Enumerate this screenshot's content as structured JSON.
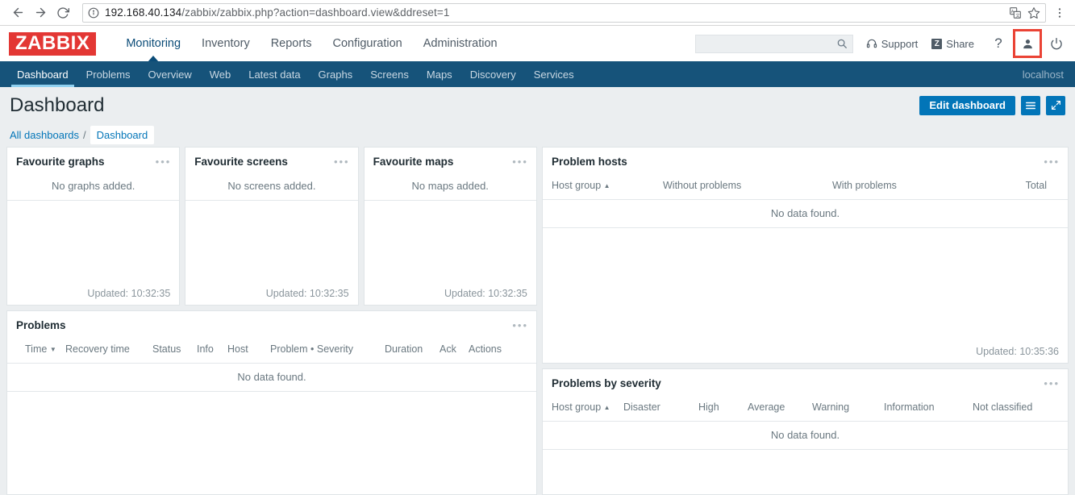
{
  "browser": {
    "back_icon": "back-arrow-icon",
    "forward_icon": "forward-arrow-icon",
    "reload_icon": "reload-icon",
    "site_info_icon": "site-info-icon",
    "url_host": "192.168.40.134",
    "url_path": "/zabbix/zabbix.php?action=dashboard.view&ddreset=1",
    "translate_icon": "translate-icon",
    "bookmark_icon": "star-icon",
    "menu_icon": "chrome-menu-icon"
  },
  "header": {
    "logo_text": "ZABBIX",
    "logo_color": "#e33734",
    "menu": [
      {
        "label": "Monitoring",
        "active": true
      },
      {
        "label": "Inventory",
        "active": false
      },
      {
        "label": "Reports",
        "active": false
      },
      {
        "label": "Configuration",
        "active": false
      },
      {
        "label": "Administration",
        "active": false
      }
    ],
    "search_value": "",
    "search_placeholder": "",
    "search_icon": "search-icon",
    "support_label": "Support",
    "support_icon": "headset-icon",
    "share_label": "Share",
    "share_icon": "zabbix-share-icon",
    "help_label": "?",
    "user_icon": "user-profile-icon",
    "user_highlight_color": "#ea4335",
    "signout_icon": "power-icon"
  },
  "nav": {
    "items": [
      {
        "label": "Dashboard",
        "active": true
      },
      {
        "label": "Problems",
        "active": false
      },
      {
        "label": "Overview",
        "active": false
      },
      {
        "label": "Web",
        "active": false
      },
      {
        "label": "Latest data",
        "active": false
      },
      {
        "label": "Graphs",
        "active": false
      },
      {
        "label": "Screens",
        "active": false
      },
      {
        "label": "Maps",
        "active": false
      },
      {
        "label": "Discovery",
        "active": false
      },
      {
        "label": "Services",
        "active": false
      }
    ],
    "host": "localhost",
    "background": "#16537a",
    "active_underline": "#8fd0f0"
  },
  "page": {
    "title": "Dashboard",
    "edit_button": "Edit dashboard",
    "menu_button_icon": "hamburger-menu-icon",
    "fullscreen_button_icon": "expand-arrows-icon",
    "accent_color": "#0275b8",
    "breadcrumb": {
      "root": "All dashboards",
      "separator": "/",
      "current": "Dashboard"
    }
  },
  "widgets": {
    "favourite_graphs": {
      "title": "Favourite graphs",
      "empty": "No graphs added.",
      "updated": "Updated: 10:32:35",
      "menu_icon": "widget-menu-icon"
    },
    "favourite_screens": {
      "title": "Favourite screens",
      "empty": "No screens added.",
      "updated": "Updated: 10:32:35",
      "menu_icon": "widget-menu-icon"
    },
    "favourite_maps": {
      "title": "Favourite maps",
      "empty": "No maps added.",
      "updated": "Updated: 10:32:35",
      "menu_icon": "widget-menu-icon"
    },
    "problem_hosts": {
      "title": "Problem hosts",
      "columns": [
        "Host group",
        "Without problems",
        "With problems",
        "Total"
      ],
      "sort_column": "Host group",
      "sort_dir": "▲",
      "no_data": "No data found.",
      "updated": "Updated: 10:35:36",
      "menu_icon": "widget-menu-icon"
    },
    "problems": {
      "title": "Problems",
      "columns": [
        "Time",
        "Recovery time",
        "Status",
        "Info",
        "Host",
        "Problem • Severity",
        "Duration",
        "Ack",
        "Actions"
      ],
      "sort_column": "Time",
      "sort_dir": "▼",
      "no_data": "No data found.",
      "menu_icon": "widget-menu-icon"
    },
    "problems_by_severity": {
      "title": "Problems by severity",
      "columns": [
        "Host group",
        "Disaster",
        "High",
        "Average",
        "Warning",
        "Information",
        "Not classified"
      ],
      "sort_column": "Host group",
      "sort_dir": "▲",
      "no_data": "No data found.",
      "menu_icon": "widget-menu-icon"
    }
  }
}
